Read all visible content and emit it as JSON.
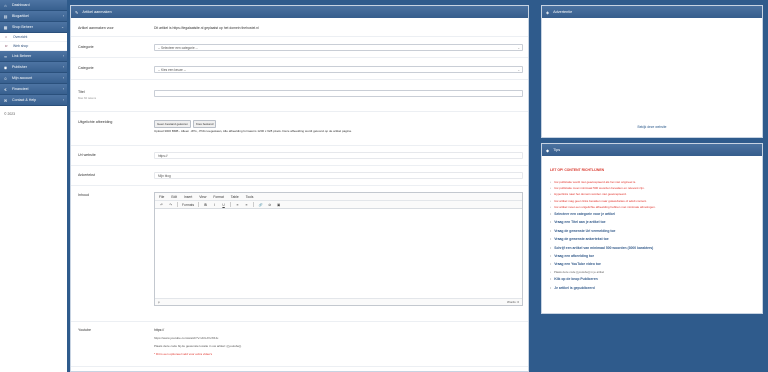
{
  "sidebar": {
    "items": [
      {
        "label": "Dashboard",
        "icon": "home-icon",
        "sub": []
      },
      {
        "label": "Blogartikel",
        "icon": "file-icon",
        "sub": []
      },
      {
        "label": "Shop Beheer",
        "icon": "store-icon",
        "sub": [
          {
            "label": "Overzicht",
            "icon": "home-icon"
          },
          {
            "label": "Web shop",
            "icon": "tag-icon"
          }
        ]
      },
      {
        "label": "Link Beheer",
        "icon": "link-icon",
        "sub": []
      },
      {
        "label": "Publisher",
        "icon": "user-icon",
        "sub": []
      },
      {
        "label": "Mijn account",
        "icon": "account-icon",
        "sub": []
      },
      {
        "label": "Financieel",
        "icon": "money-icon",
        "sub": []
      },
      {
        "label": "Contact & Help",
        "icon": "help-icon",
        "sub": []
      }
    ],
    "copyright": "© 2023"
  },
  "form": {
    "title": "Artikel aanmaken",
    "fields": {
      "domain": {
        "label": "Artikel aanmaken voor",
        "value": "Dit artikel is https://legalaatsite.nl geplaatst op het domein thehostel.nl"
      },
      "category": {
        "label": "Categorie",
        "placeholder": "-- Selecteer een categorie --"
      },
      "subcategory": {
        "label": "Categorie",
        "placeholder": "-- Kies een keuze --"
      },
      "title": {
        "label": "Titel",
        "note": "Max 60 tekens"
      },
      "image": {
        "label": "Uitgelichte afbeelding",
        "file_button": "Kies bestand",
        "file_status": "Geen bestand gekozen",
        "help": "Upload 3000 BMB - Alleen .JPG, .PNG toegestaan, Alle afbeelding formaat is 1200 x 628 pixels. Deze afbeelding wordt getoond op de artikel pagina."
      },
      "url": {
        "label": "Url website",
        "value": "https://"
      },
      "anchor": {
        "label": "Ankertekst",
        "value": "Mijn blog"
      },
      "content": {
        "label": "Inhoud"
      },
      "video": {
        "label": "Youtube",
        "value": "https://",
        "example": "https://www.youtube.com/watch?v=vbGJVvX6Ju",
        "help": "Plaats deze code bij de gewenste locatie in uw artikel: {{youtube}}",
        "warning": "* Dit is een optioneel veld voor extra video's"
      }
    },
    "editor": {
      "menu": [
        "File",
        "Edit",
        "Insert",
        "View",
        "Format",
        "Table",
        "Tools"
      ],
      "toolbar": [
        "↶",
        "↷",
        "Formats",
        "B",
        "I",
        "U",
        "≡",
        "≡",
        "🔗",
        "⊘",
        "▣"
      ],
      "status_left": "p",
      "status_right": "Words: 0"
    }
  },
  "ad": {
    "title": "Advertentie",
    "link": "Bekijk deze website"
  },
  "tips": {
    "title": "Tips",
    "heading": "LET OP! CONTENT RICHTLIJNEN",
    "items": [
      {
        "text": "Uw publicatie wordt niet geaccepteerd als het niet origineel is.",
        "style": "red"
      },
      {
        "text": "Uw publicatie moet minimaal 500 woorden bevatten en relevant zijn.",
        "style": "red"
      },
      {
        "text": "Hyperlinks naar het domein worden niet geaccepteerd.",
        "style": "red"
      },
      {
        "text": "Uw artikel mag geen links bevatten naar gokwebsites of adult content.",
        "style": "red"
      },
      {
        "text": "Uw artikel moet een uitgelichte afbeelding hebben met minimale afmetingen.",
        "style": "red"
      },
      {
        "text": "Selecteer een categorie voor je artikel",
        "style": "blue"
      },
      {
        "text": "Vraag een Titel aan je artikel toe",
        "style": "blue"
      },
      {
        "text": "Vraag de gewenste Url vermelding toe",
        "style": "blue"
      },
      {
        "text": "Vraag de gewenste ankertekst toe",
        "style": "blue"
      },
      {
        "text": "Schrijf een artikel van minimaal 500 woorden (3000 karakters)",
        "style": "blue"
      },
      {
        "text": "Vraag een afbeelding toe",
        "style": "blue"
      },
      {
        "text": "Vraag een YouTube video toe",
        "style": "blue"
      },
      {
        "text": "Plaats deze code {{youtube}} in je artikel",
        "style": "grey"
      },
      {
        "text": "Klik op de knop Publiceren",
        "style": "blue"
      },
      {
        "text": "Je artikel is gepubliceerd",
        "style": "blue"
      }
    ]
  },
  "colors": {
    "background": "#2f5b8c",
    "header": "#3f6796",
    "warning": "#e0332b",
    "link": "#345b8b"
  }
}
